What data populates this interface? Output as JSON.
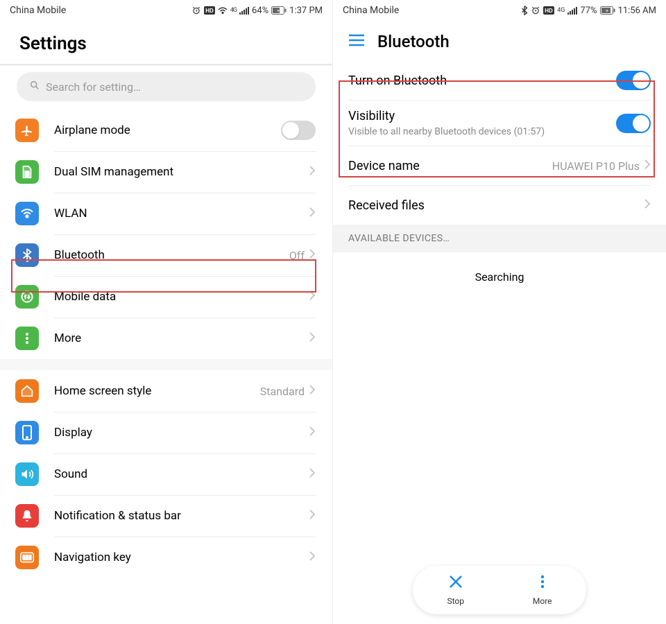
{
  "left": {
    "status": {
      "carrier": "China Mobile",
      "battery": "64%",
      "time": "1:37 PM"
    },
    "title": "Settings",
    "search_placeholder": "Search for setting…",
    "items": {
      "airplane": {
        "label": "Airplane mode"
      },
      "dualsim": {
        "label": "Dual SIM management"
      },
      "wlan": {
        "label": "WLAN"
      },
      "bluetooth": {
        "label": "Bluetooth",
        "value": "Off"
      },
      "mobiledata": {
        "label": "Mobile data"
      },
      "more": {
        "label": "More"
      },
      "homescreen": {
        "label": "Home screen style",
        "value": "Standard"
      },
      "display": {
        "label": "Display"
      },
      "sound": {
        "label": "Sound"
      },
      "notif": {
        "label": "Notification & status bar"
      },
      "navkey": {
        "label": "Navigation key"
      }
    }
  },
  "right": {
    "status": {
      "carrier": "China Mobile",
      "battery": "77%",
      "time": "11:56 AM"
    },
    "title": "Bluetooth",
    "turn_on": {
      "label": "Turn on Bluetooth"
    },
    "visibility": {
      "label": "Visibility",
      "sub": "Visible to all nearby Bluetooth devices (01:57)"
    },
    "device_name": {
      "label": "Device name",
      "value": "HUAWEI P10 Plus"
    },
    "received": {
      "label": "Received files"
    },
    "avail_header": "AVAILABLE DEVICES…",
    "searching": "Searching",
    "stop": "Stop",
    "more": "More"
  }
}
